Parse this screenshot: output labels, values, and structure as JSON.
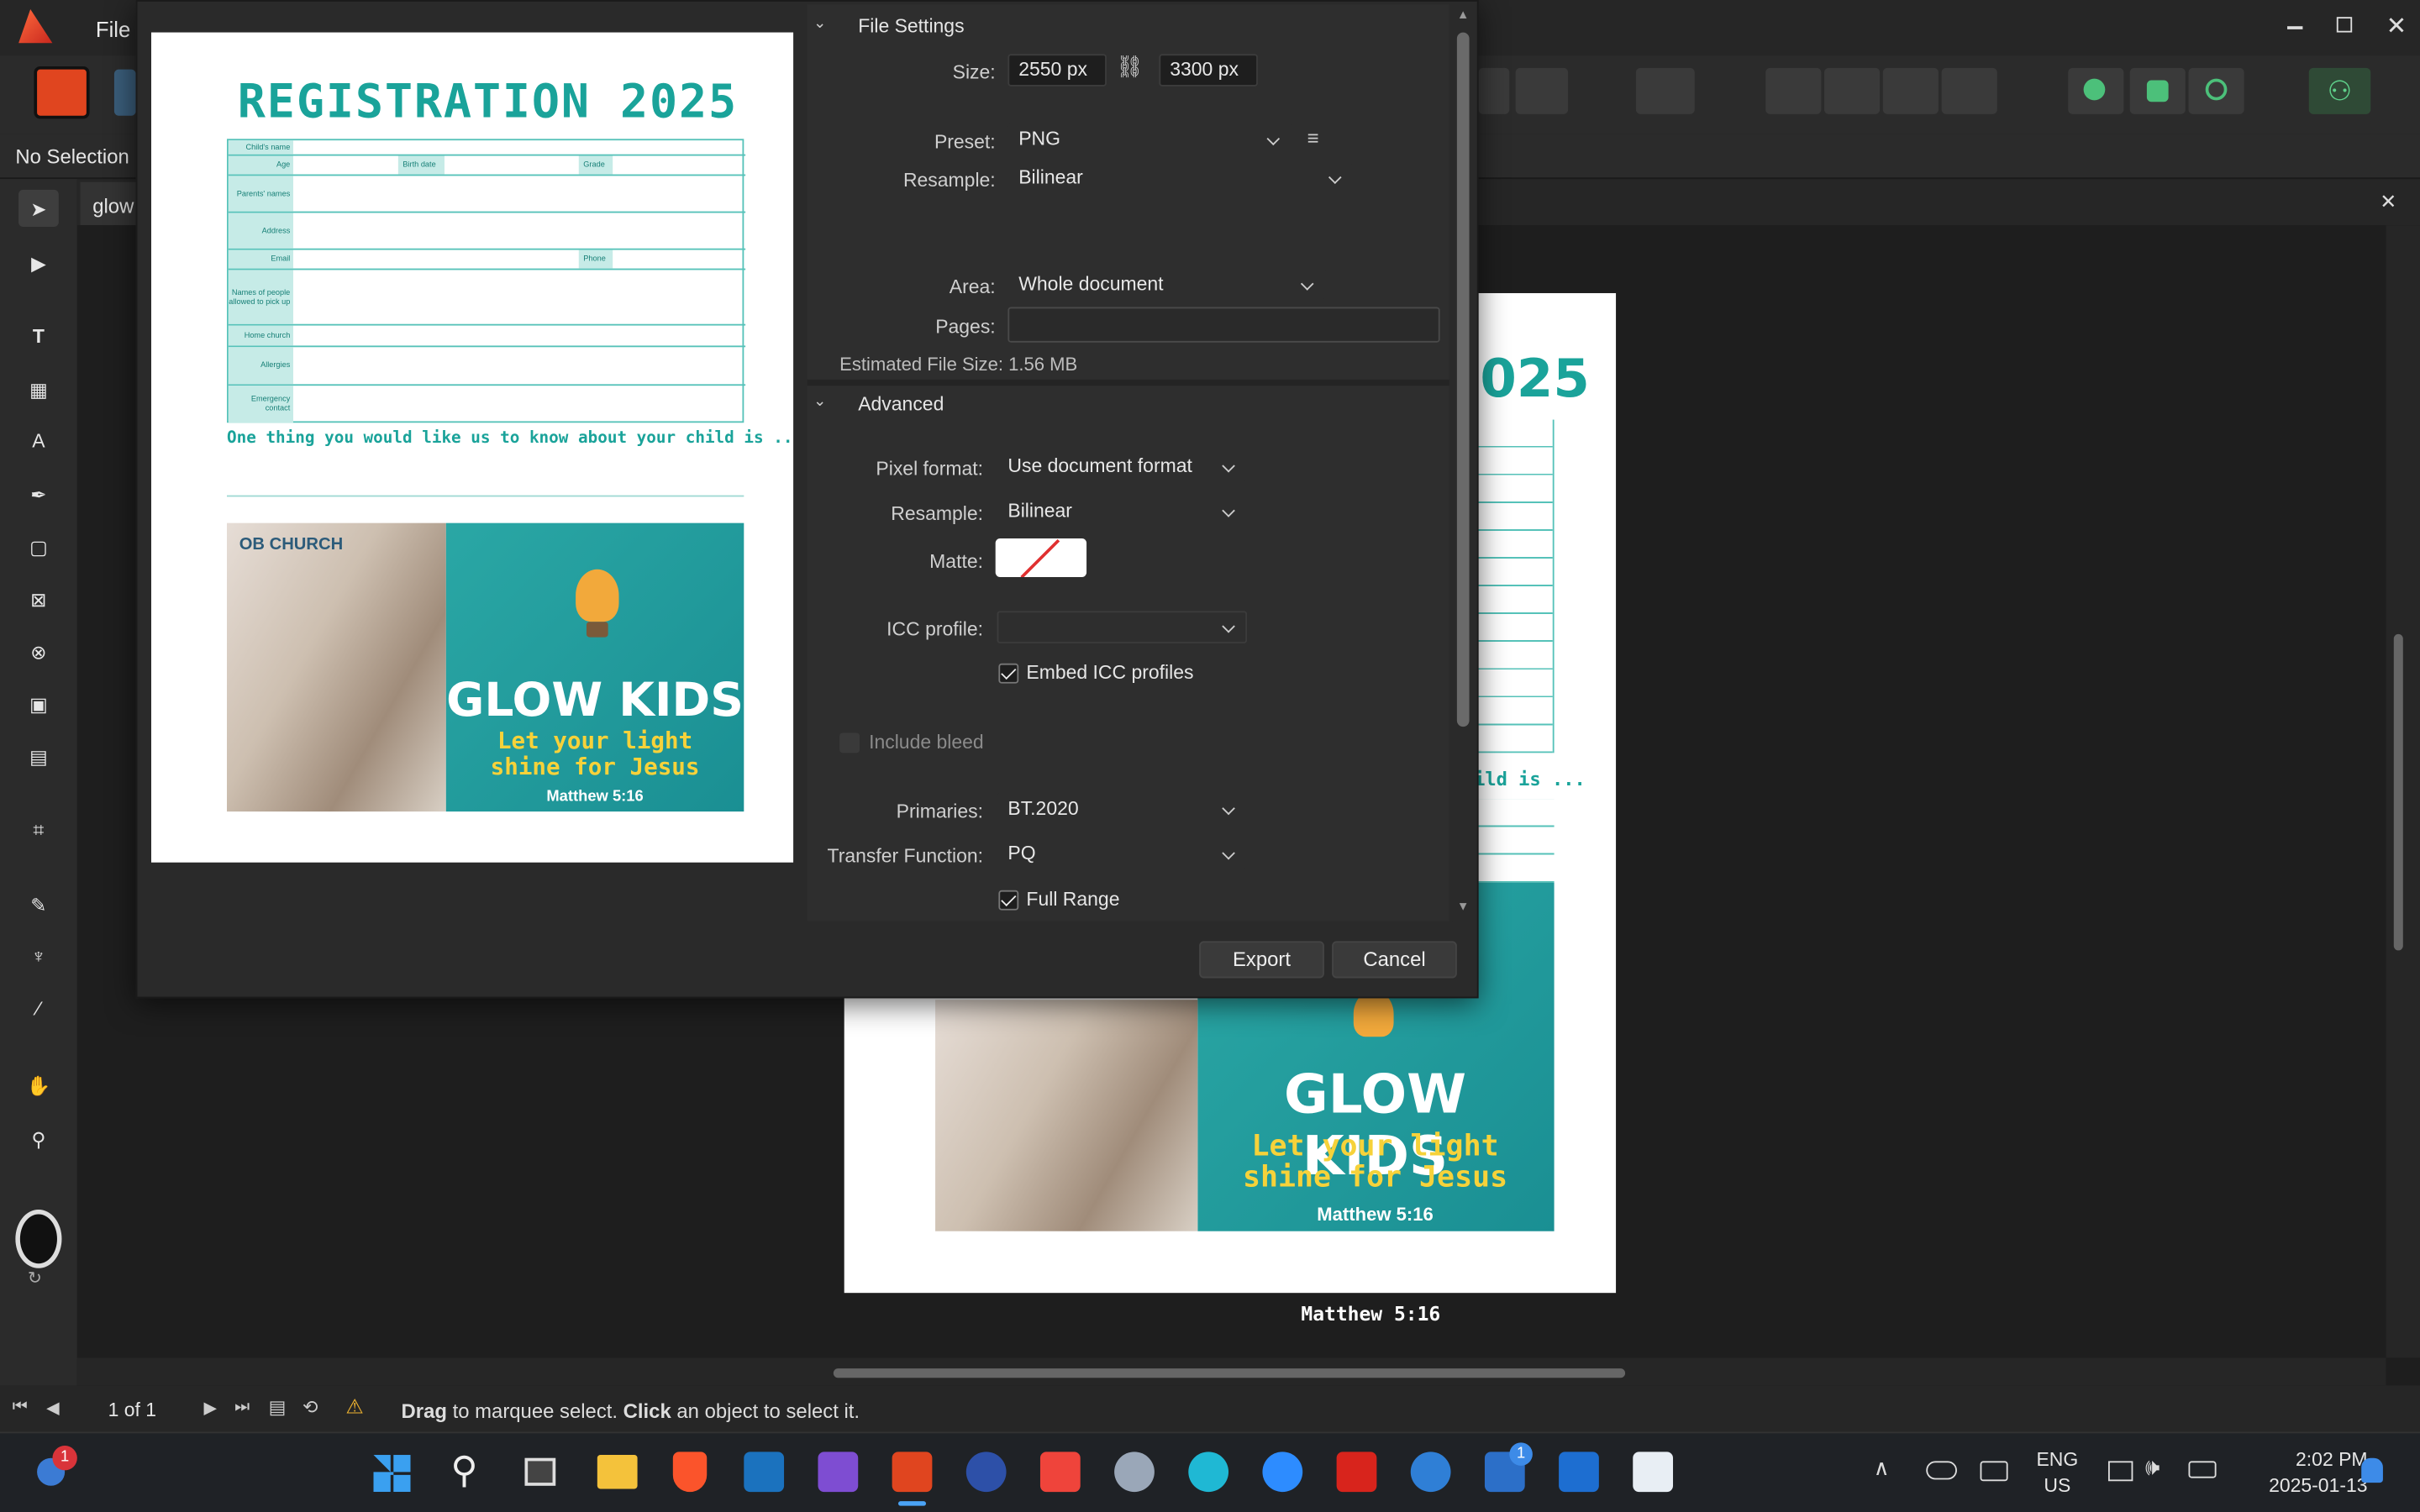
{
  "app": {
    "menu_file": "File",
    "no_selection": "No Selection",
    "doc_tab": "glow"
  },
  "dialog": {
    "preview": {
      "title": "REGISTRATION 2025",
      "fields": [
        "Child's name",
        "Age",
        "Parents' names",
        "Address",
        "Email",
        "Names of people allowed to pick up",
        "Home church",
        "Allergies",
        "Emergency contact"
      ],
      "sub_fields": {
        "birth_date": "Birth date",
        "grade": "Grade",
        "phone": "Phone"
      },
      "prompt": "One thing you would like us to know about your child is ...",
      "church": "OB CHURCH",
      "glow_kids": "GLOW KIDS",
      "tagline_1": "Let your light",
      "tagline_2": "shine for Jesus",
      "verse": "Matthew 5:16"
    },
    "file_settings": {
      "section": "File Settings",
      "size_label": "Size:",
      "width": "2550 px",
      "height": "3300 px",
      "preset_label": "Preset:",
      "preset": "PNG",
      "resample_label": "Resample:",
      "resample": "Bilinear",
      "area_label": "Area:",
      "area": "Whole document",
      "pages_label": "Pages:",
      "pages": "",
      "estimated": "Estimated File Size: 1.56 MB"
    },
    "advanced": {
      "section": "Advanced",
      "pixel_format_label": "Pixel format:",
      "pixel_format": "Use document format",
      "resample_label": "Resample:",
      "resample": "Bilinear",
      "matte_label": "Matte:",
      "icc_label": "ICC profile:",
      "icc": "",
      "embed_icc": "Embed ICC profiles",
      "embed_icc_checked": true,
      "include_bleed": "Include bleed",
      "include_bleed_checked": false,
      "primaries_label": "Primaries:",
      "primaries": "BT.2020",
      "transfer_label": "Transfer Function:",
      "transfer": "PQ",
      "full_range": "Full Range",
      "full_range_checked": true
    },
    "export_button": "Export",
    "cancel_button": "Cancel"
  },
  "background_doc": {
    "title_fragment": "025",
    "line_fragment": "ild is ...",
    "glow_kids": "GLOW KIDS",
    "tagline_1": "Let your light",
    "tagline_2": "shine for Jesus",
    "verse": "Matthew 5:16",
    "verse_below": "Matthew 5:16"
  },
  "status": {
    "page": "1 of 1",
    "hint_drag": "Drag",
    "hint_drag_text": " to marquee select. ",
    "hint_click": "Click",
    "hint_click_text": " an object to select it."
  },
  "taskbar": {
    "notification_badge": "1",
    "teams_badge": "1",
    "lang_1": "ENG",
    "lang_2": "US",
    "time": "2:02 PM",
    "date": "2025-01-13"
  },
  "colors": {
    "accent_teal": "#1aa39a",
    "brand_red": "#e0451f",
    "tagline_yellow": "#f6d23a"
  }
}
